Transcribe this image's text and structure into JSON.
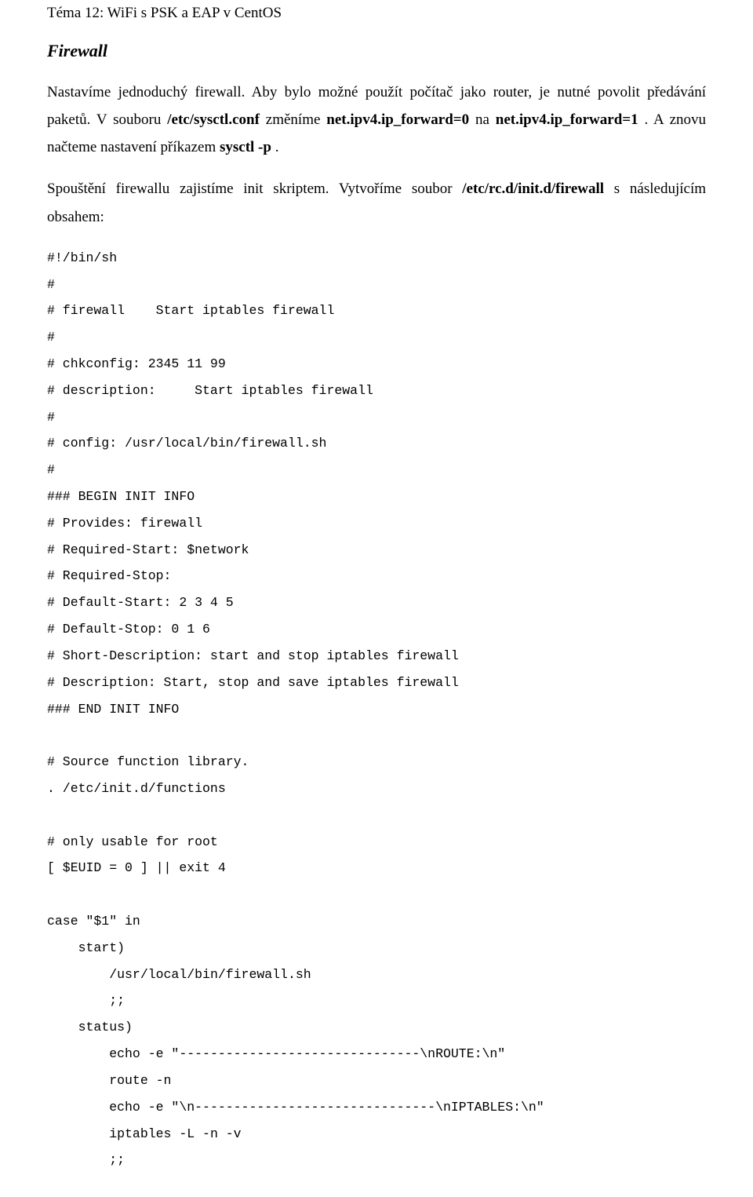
{
  "header": "Téma 12: WiFi s PSK a EAP v CentOS",
  "subtitle": "Firewall",
  "para1_html": "Nastavíme jednoduchý firewall. Aby bylo možné použít počítač jako router, je nutné povolit předávání paketů. V souboru <b>/etc/sysctl.conf</b> změníme <b>net.ipv4.ip_forward=0</b> na <b>net.ipv4.ip_forward=1</b> . A znovu načteme nastavení příkazem <b>sysctl -p</b> .",
  "para2_html": "Spouštění firewallu zajistíme init skriptem. Vytvoříme soubor <b>/etc/rc.d/init.d/firewall</b> s následujícím obsahem:",
  "code": "#!/bin/sh\n#\n# firewall    Start iptables firewall\n#\n# chkconfig: 2345 11 99\n# description:     Start iptables firewall\n#\n# config: /usr/local/bin/firewall.sh\n#\n### BEGIN INIT INFO\n# Provides: firewall\n# Required-Start: $network\n# Required-Stop:\n# Default-Start: 2 3 4 5\n# Default-Stop: 0 1 6\n# Short-Description: start and stop iptables firewall\n# Description: Start, stop and save iptables firewall\n### END INIT INFO\n\n# Source function library.\n. /etc/init.d/functions\n\n# only usable for root\n[ $EUID = 0 ] || exit 4\n\ncase \"$1\" in\n    start)\n        /usr/local/bin/firewall.sh\n        ;;\n    status)\n        echo -e \"-------------------------------\\nROUTE:\\n\"\n        route -n\n        echo -e \"\\n-------------------------------\\nIPTABLES:\\n\"\n        iptables -L -n -v\n        ;;"
}
